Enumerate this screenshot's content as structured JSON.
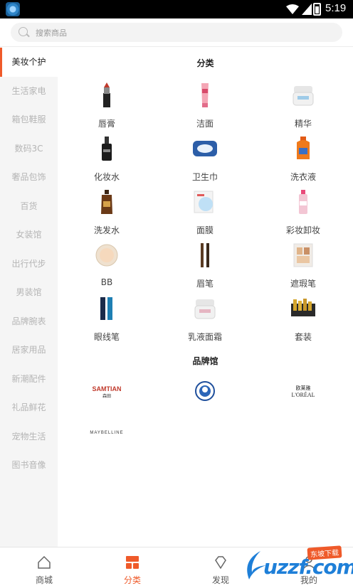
{
  "statusbar": {
    "time": "5:19"
  },
  "search": {
    "placeholder": "搜索商品"
  },
  "sidebar": {
    "items": [
      {
        "label": "美妆个护",
        "active": true
      },
      {
        "label": "生活家电"
      },
      {
        "label": "箱包鞋服"
      },
      {
        "label": "数码3C"
      },
      {
        "label": "奢品包饰"
      },
      {
        "label": "百货"
      },
      {
        "label": "女装馆"
      },
      {
        "label": "出行代步"
      },
      {
        "label": "男装馆"
      },
      {
        "label": "品牌腕表"
      },
      {
        "label": "居家用品"
      },
      {
        "label": "新潮配件"
      },
      {
        "label": "礼品鲜花"
      },
      {
        "label": "宠物生活"
      },
      {
        "label": "图书音像"
      }
    ]
  },
  "content": {
    "category_title": "分类",
    "categories": [
      {
        "label": "唇膏",
        "icon": "lipstick-icon"
      },
      {
        "label": "洁面",
        "icon": "cleanser-tube-icon"
      },
      {
        "label": "精华",
        "icon": "cream-jar-icon"
      },
      {
        "label": "化妆水",
        "icon": "serum-bottle-icon"
      },
      {
        "label": "卫生巾",
        "icon": "pad-pack-icon"
      },
      {
        "label": "洗衣液",
        "icon": "detergent-bottle-icon"
      },
      {
        "label": "洗发水",
        "icon": "shampoo-bottle-icon"
      },
      {
        "label": "面膜",
        "icon": "mask-pack-icon"
      },
      {
        "label": "彩妆卸妆",
        "icon": "remover-bottle-icon"
      },
      {
        "label": "BB",
        "icon": "compact-icon"
      },
      {
        "label": "眉笔",
        "icon": "brow-pencil-icon"
      },
      {
        "label": "遮瑕笔",
        "icon": "concealer-palette-icon"
      },
      {
        "label": "眼线笔",
        "icon": "eyeliner-icon"
      },
      {
        "label": "乳液面霜",
        "icon": "cream-jar-icon"
      },
      {
        "label": "套装",
        "icon": "gift-set-icon"
      }
    ],
    "brand_title": "品牌馆",
    "brands": [
      {
        "name": "SAMTIAN 森田",
        "icon": "samtian-logo"
      },
      {
        "name": "Mentholatum",
        "icon": "mentholatum-logo"
      },
      {
        "name": "欧莱雅 L'OREAL",
        "icon": "loreal-logo"
      },
      {
        "name": "MAYBELLINE",
        "icon": "maybelline-logo"
      }
    ]
  },
  "bottomnav": {
    "items": [
      {
        "label": "商城",
        "icon": "home-icon"
      },
      {
        "label": "分类",
        "icon": "category-icon",
        "active": true
      },
      {
        "label": "发现",
        "icon": "discover-icon"
      },
      {
        "label": "我的",
        "icon": "profile-icon"
      }
    ]
  },
  "watermark": {
    "text": "uzzf.com",
    "badge": "东坡下载"
  },
  "colors": {
    "accent": "#ef5a2a",
    "sidebar_bg": "#f5f5f5",
    "watermark_blue": "#1e7fd8"
  }
}
